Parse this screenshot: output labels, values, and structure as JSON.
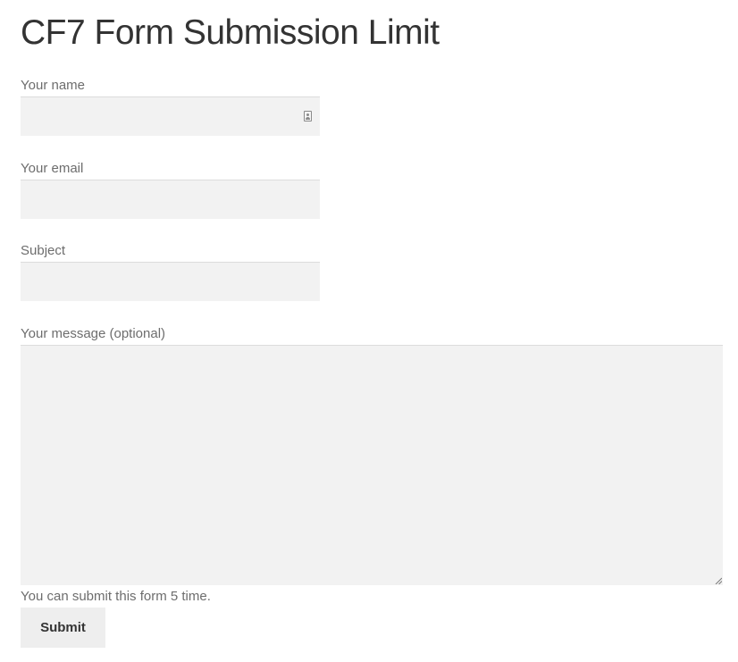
{
  "page": {
    "title": "CF7 Form Submission Limit"
  },
  "form": {
    "name": {
      "label": "Your name",
      "value": "",
      "placeholder": ""
    },
    "email": {
      "label": "Your email",
      "value": "",
      "placeholder": ""
    },
    "subject": {
      "label": "Subject",
      "value": "",
      "placeholder": ""
    },
    "message": {
      "label": "Your message (optional)",
      "value": "",
      "placeholder": ""
    },
    "limit_note": "You can submit this form 5 time.",
    "submit_label": "Submit"
  },
  "icons": {
    "name_field_icon": "contact-card-autofill-icon",
    "textarea_grip": "resize-grip-icon"
  },
  "colors": {
    "field_background": "#f2f2f2",
    "button_background": "#eeeeee",
    "title_text": "#333333",
    "label_text": "#6d6d6d"
  }
}
